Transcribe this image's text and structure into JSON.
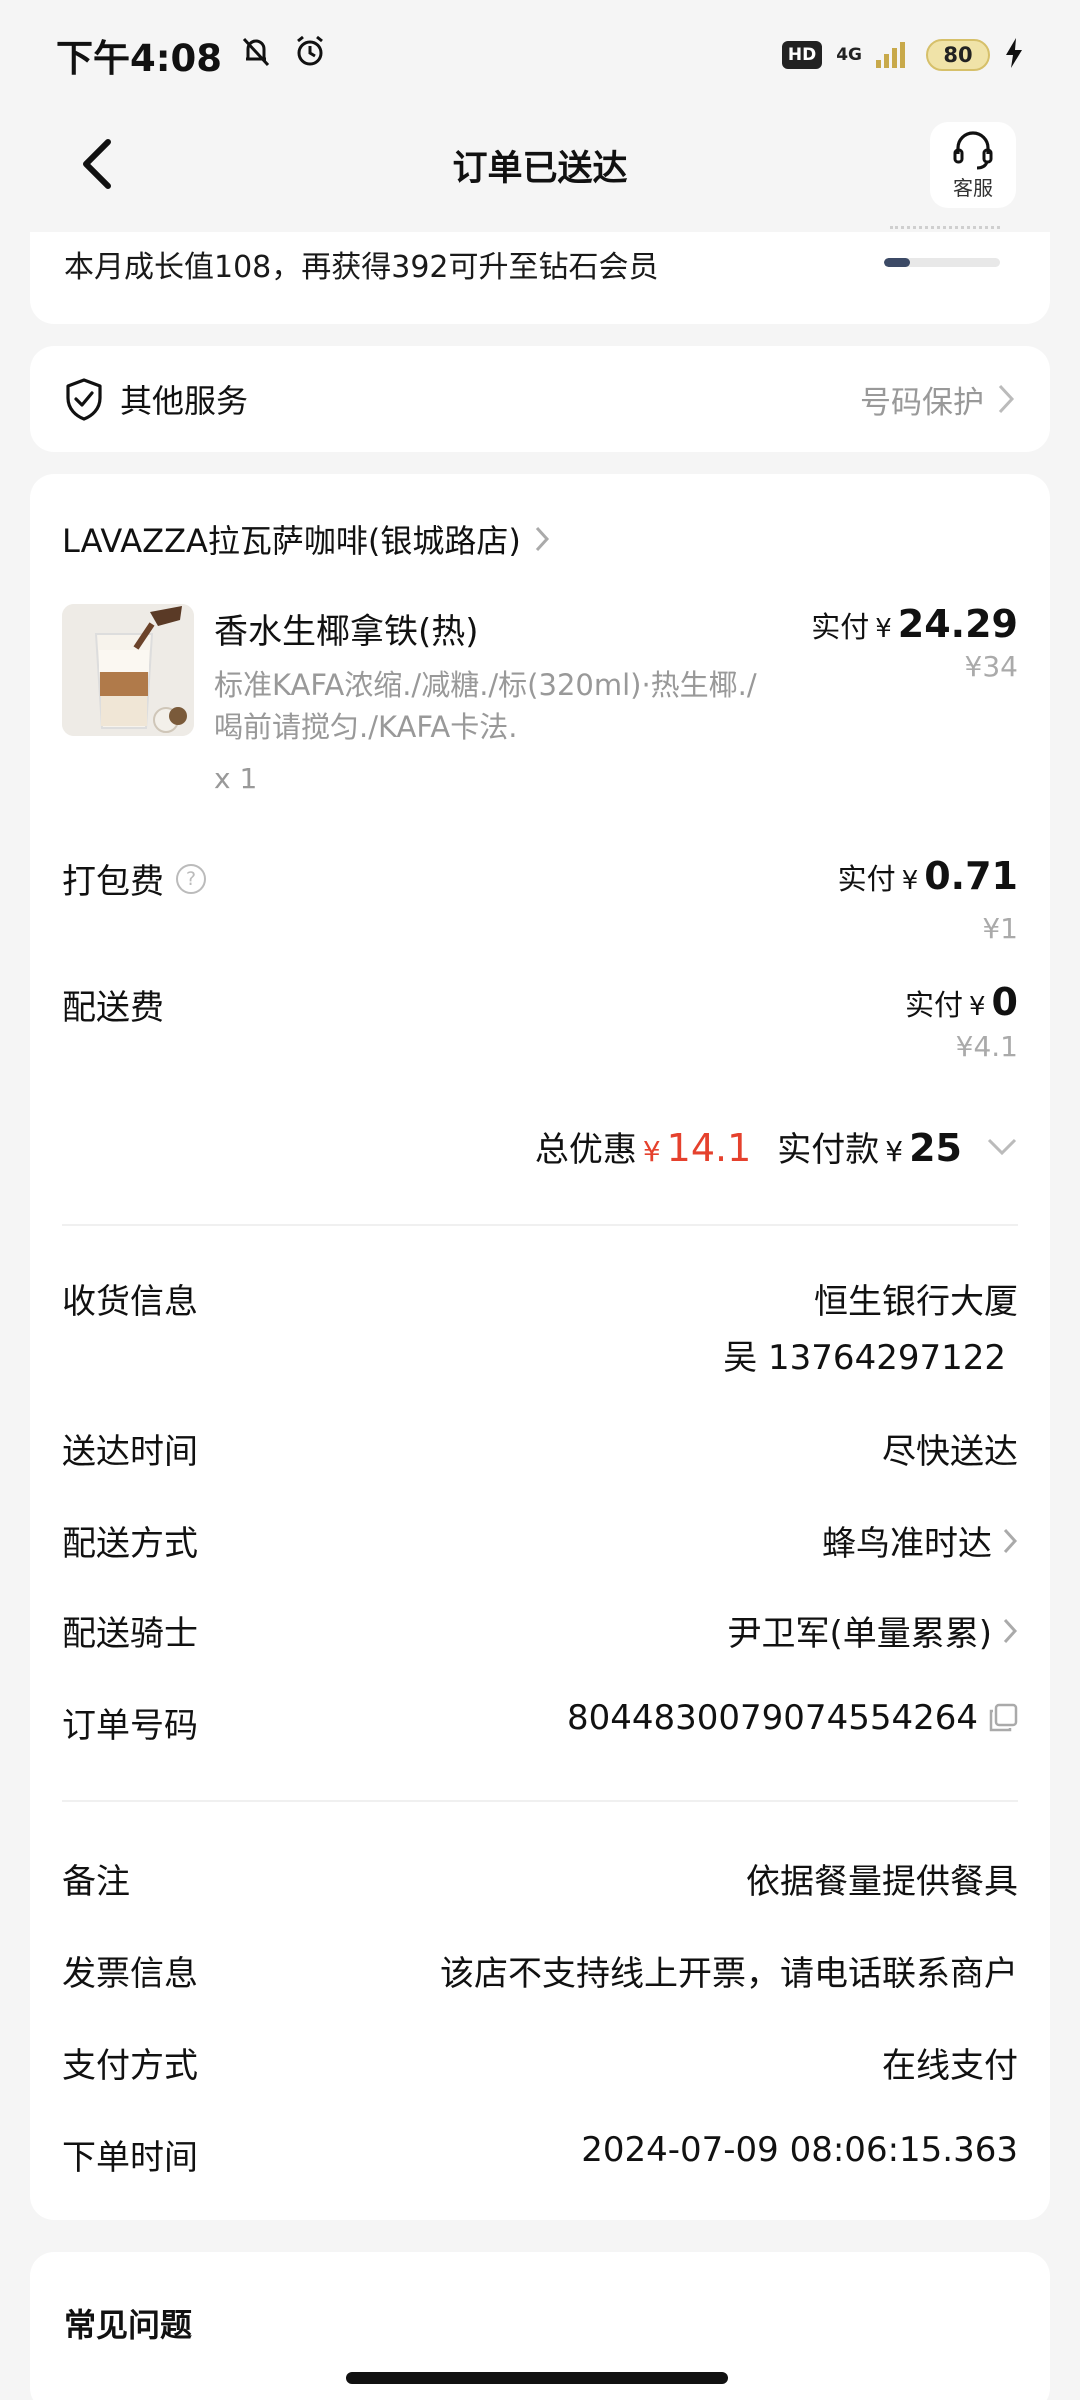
{
  "status_bar": {
    "time": "下午4:08",
    "hd": "HD",
    "network": "4G",
    "battery": "80"
  },
  "header": {
    "title": "订单已送达",
    "customer_service_label": "客服"
  },
  "membership": {
    "growth_text": "本月成长值108，再获得392可升至钻石会员",
    "progress": 0.22
  },
  "service": {
    "label": "其他服务",
    "right_text": "号码保护"
  },
  "order": {
    "store_name": "LAVAZZA拉瓦萨咖啡(银城路店)",
    "item": {
      "name": "香水生椰拿铁(热)",
      "spec": "标准KAFA浓缩./减糖./标(320ml)·热生椰./喝前请搅匀./KAFA卡法.",
      "qty": "x 1",
      "paid_label": "实付",
      "currency": "¥",
      "paid_amount": "24.29",
      "original_price": "¥34"
    },
    "packing_fee": {
      "label": "打包费",
      "help": "?",
      "paid_label": "实付",
      "currency": "¥",
      "paid_amount": "0.71",
      "original": "¥1"
    },
    "delivery_fee": {
      "label": "配送费",
      "paid_label": "实付",
      "currency": "¥",
      "paid_amount": "0",
      "original": "¥4.1"
    },
    "totals": {
      "discount_label": "总优惠",
      "currency": "¥",
      "discount_amount": "14.1",
      "paid_label": "实付款",
      "paid_amount": "25"
    },
    "details": [
      {
        "label": "收货信息",
        "value": "恒生银行大厦",
        "value2": "吴 13764297122"
      },
      {
        "label": "送达时间",
        "value": "尽快送达"
      },
      {
        "label": "配送方式",
        "value": "蜂鸟准时达"
      },
      {
        "label": "配送骑士",
        "value": "尹卫军(单量累累)"
      },
      {
        "label": "订单号码",
        "value": "8044830079074554264"
      }
    ],
    "extra": [
      {
        "label": "备注",
        "value": "依据餐量提供餐具"
      },
      {
        "label": "发票信息",
        "value": "该店不支持线上开票，请电话联系商户"
      },
      {
        "label": "支付方式",
        "value": "在线支付"
      },
      {
        "label": "下单时间",
        "value": "2024-07-09 08:06:15.363"
      }
    ]
  },
  "faq": {
    "title": "常见问题"
  },
  "colors": {
    "accent_red": "#e5412d",
    "background": "#f5f5f5",
    "muted": "#999999"
  }
}
